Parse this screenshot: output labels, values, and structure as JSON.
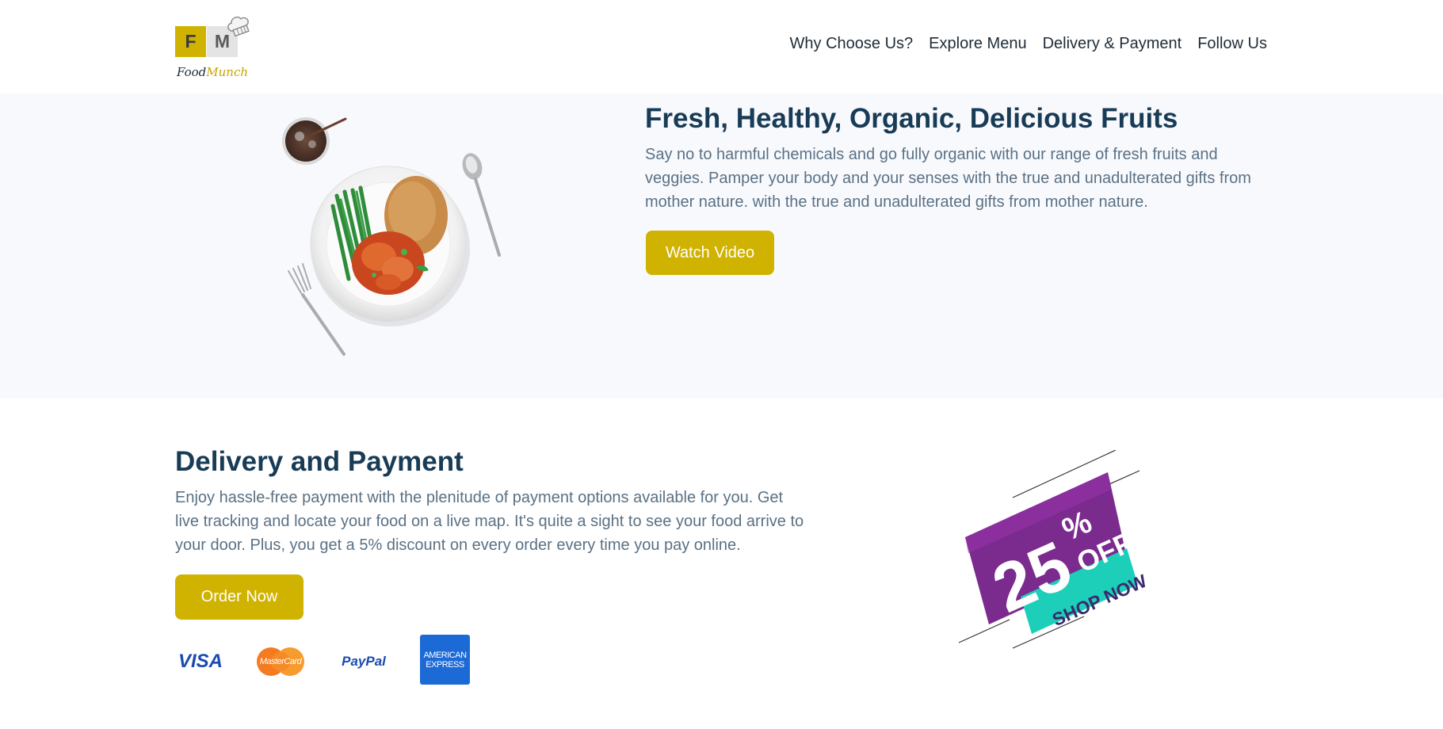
{
  "brand": {
    "logo_left": "F",
    "logo_right": "M",
    "name_part1": "Food",
    "name_part2": "Munch"
  },
  "nav": {
    "items": [
      {
        "label": "Why Choose Us?"
      },
      {
        "label": "Explore Menu"
      },
      {
        "label": "Delivery & Payment"
      },
      {
        "label": "Follow Us"
      }
    ]
  },
  "hero": {
    "title": "Fresh, Healthy, Organic, Delicious Fruits",
    "description": "Say no to harmful chemicals and go fully organic with our range of fresh fruits and veggies. Pamper your body and your senses with the true and unadulterated gifts from mother nature. with the true and unadulterated gifts from mother nature.",
    "button_label": "Watch Video"
  },
  "delivery": {
    "title": "Delivery and Payment",
    "description": "Enjoy hassle-free payment with the plenitude of payment options available for you. Get live tracking and locate your food on a live map. It's quite a sight to see your food arrive to your door. Plus, you get a 5% discount on every order every time you pay online.",
    "button_label": "Order Now",
    "payment_methods": {
      "visa": "VISA",
      "mastercard": "MasterCard",
      "paypal": "PayPal",
      "amex_line1": "AMERICAN",
      "amex_line2": "EXPRESS"
    }
  },
  "promo": {
    "big": "25",
    "percent": "%",
    "off": "OFF",
    "shop": "SHOP NOW"
  },
  "colors": {
    "accent": "#d0b200",
    "heading": "#183b56",
    "body_text": "#5a7184",
    "hero_bg": "#f8f9fd",
    "promo_purple": "#7b2a8e",
    "promo_teal": "#1dcfb8"
  }
}
